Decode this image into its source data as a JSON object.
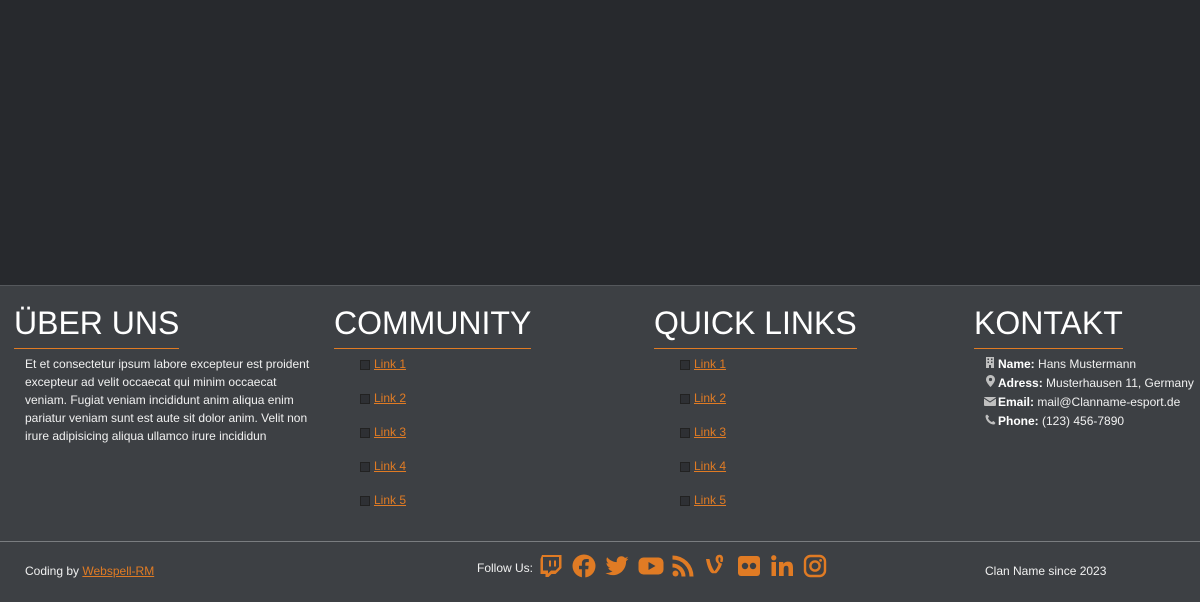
{
  "about": {
    "title": "ÜBER UNS",
    "text": "Et et consectetur ipsum labore excepteur est proident excepteur ad velit occaecat qui minim occaecat veniam. Fugiat veniam incididunt anim aliqua enim pariatur veniam sunt est aute sit dolor anim. Velit non irure adipisicing aliqua ullamco irure incididun"
  },
  "community": {
    "title": "COMMUNITY",
    "links": [
      "Link 1",
      "Link 2",
      "Link 3",
      "Link 4",
      "Link 5"
    ]
  },
  "quick_links": {
    "title": "QUICK LINKS",
    "links": [
      "Link 1",
      "Link 2",
      "Link 3",
      "Link 4",
      "Link 5"
    ]
  },
  "contact": {
    "title": "KONTAKT",
    "name_label": "Name:",
    "name_value": "Hans Mustermann",
    "address_label": "Adress:",
    "address_value": "Musterhausen 11, Germany",
    "email_label": "Email:",
    "email_value": "mail@Clanname-esport.de",
    "phone_label": "Phone:",
    "phone_value": "(123) 456-7890",
    "icons": [
      "building-icon",
      "map-marker-icon",
      "envelope-icon",
      "phone-icon"
    ]
  },
  "bottom": {
    "coding_prefix": "Coding by",
    "coding_link": "Webspell-RM",
    "follow_label": "Follow Us:",
    "social_icons": [
      "twitch-icon",
      "facebook-icon",
      "twitter-icon",
      "youtube-icon",
      "rss-icon",
      "vine-icon",
      "flickr-icon",
      "linkedin-icon",
      "instagram-icon"
    ],
    "since": "Clan Name since 2023"
  },
  "colors": {
    "accent": "#e07b24",
    "footer_bg": "#3d4044",
    "page_bg": "#27292d"
  }
}
